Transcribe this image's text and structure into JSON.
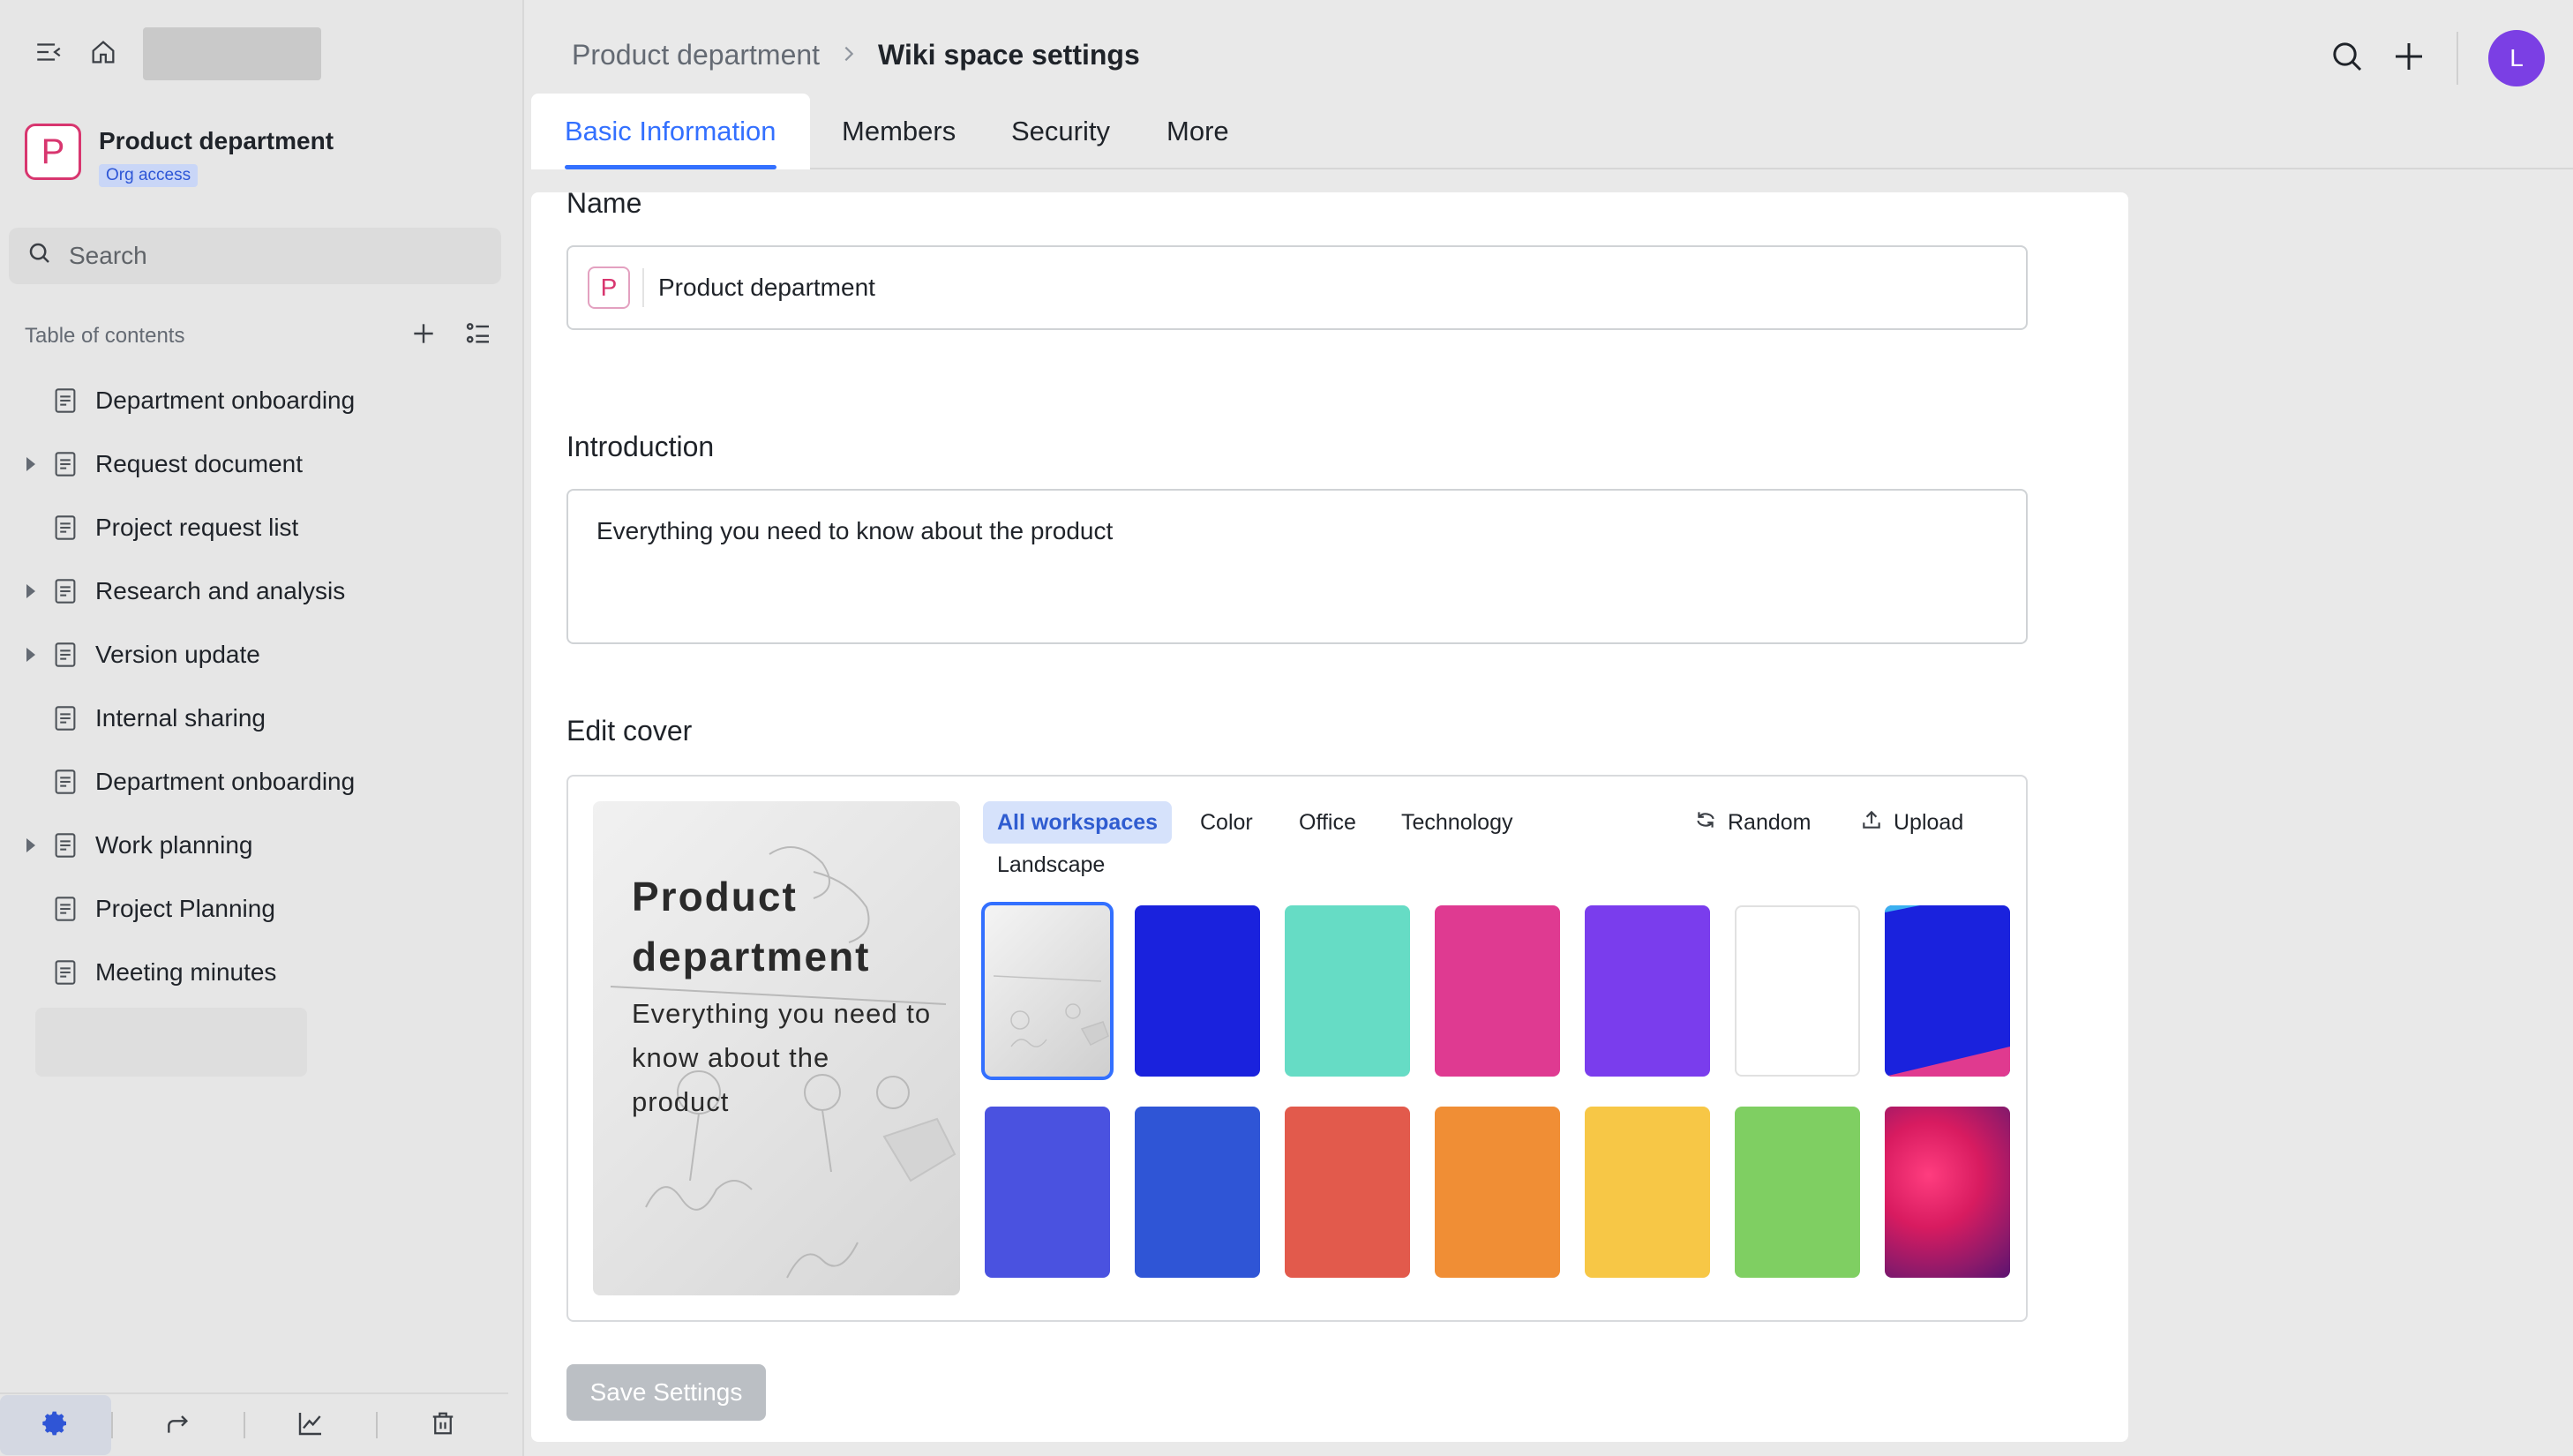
{
  "sidebar": {
    "space": {
      "avatar_letter": "P",
      "name": "Product department",
      "badge": "Org access"
    },
    "search_placeholder": "Search",
    "toc_label": "Table of contents",
    "items": [
      {
        "label": "Department onboarding",
        "has_children": false
      },
      {
        "label": "Request document",
        "has_children": true
      },
      {
        "label": "Project request list",
        "has_children": false
      },
      {
        "label": "Research and analysis",
        "has_children": true
      },
      {
        "label": "Version update",
        "has_children": true
      },
      {
        "label": "Internal sharing",
        "has_children": false
      },
      {
        "label": "Department onboarding",
        "has_children": false
      },
      {
        "label": "Work planning",
        "has_children": true
      },
      {
        "label": "Project Planning",
        "has_children": false
      },
      {
        "label": "Meeting minutes",
        "has_children": false
      }
    ],
    "bottom_icons": [
      "settings-icon",
      "share-icon",
      "analytics-icon",
      "trash-icon"
    ]
  },
  "header": {
    "breadcrumb": [
      "Product department",
      "Wiki space settings"
    ],
    "user_initial": "L"
  },
  "tabs": [
    {
      "label": "Basic Information",
      "active": true
    },
    {
      "label": "Members",
      "active": false
    },
    {
      "label": "Security",
      "active": false
    },
    {
      "label": "More",
      "active": false
    }
  ],
  "form": {
    "name_label": "Name",
    "name_icon_letter": "P",
    "name_value": "Product department",
    "intro_label": "Introduction",
    "intro_value": "Everything you need to know about the product",
    "cover_label": "Edit cover",
    "preview_title": "Product department",
    "preview_subtitle": "Everything you need to know about the product",
    "categories": [
      "All workspaces",
      "Color",
      "Office",
      "Technology",
      "Landscape"
    ],
    "active_category": "All workspaces",
    "random_label": "Random",
    "upload_label": "Upload",
    "save_label": "Save Settings"
  },
  "swatches": [
    {
      "name": "cover-swatch-whiteboard",
      "color": "photo",
      "selected": true
    },
    {
      "name": "cover-swatch-blue",
      "color": "#1a22dd"
    },
    {
      "name": "cover-swatch-mint",
      "color": "#66dcc5"
    },
    {
      "name": "cover-swatch-pink",
      "color": "#df3a91"
    },
    {
      "name": "cover-swatch-purple",
      "color": "#7a3ded"
    },
    {
      "name": "cover-swatch-white",
      "color": "#ffffff"
    },
    {
      "name": "cover-swatch-blue-split",
      "color": "#1a22dd"
    },
    {
      "name": "cover-swatch-indigo",
      "color": "#4a52e0"
    },
    {
      "name": "cover-swatch-royal-blue",
      "color": "#2f55d6"
    },
    {
      "name": "cover-swatch-red",
      "color": "#e25a4c"
    },
    {
      "name": "cover-swatch-orange",
      "color": "#f08e35"
    },
    {
      "name": "cover-swatch-yellow",
      "color": "#f7c746"
    },
    {
      "name": "cover-swatch-green",
      "color": "#7fcf62"
    },
    {
      "name": "cover-swatch-flower",
      "color": "photo"
    }
  ],
  "colors": {
    "accent": "#3370ff",
    "brand_pink": "#d8366f",
    "avatar_purple": "#7b3fe4"
  }
}
